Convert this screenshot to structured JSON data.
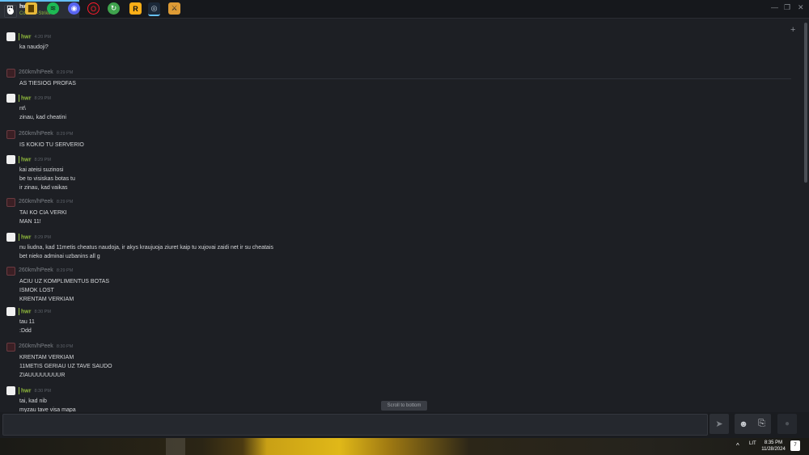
{
  "tab": {
    "name": "hwr",
    "game": "Counter-Strike 2"
  },
  "window_controls": {
    "minimize": "—",
    "restore": "❐",
    "close": "✕"
  },
  "messages": [
    {
      "sender": "hwr",
      "type": "hwr",
      "time": "4:20 PM",
      "lines": [
        "ka naudoji?"
      ]
    },
    {
      "sender": "260km/hPeek",
      "type": "peek",
      "time": "8:29 PM",
      "lines": [
        "AS TIESIOG PROFAS"
      ]
    },
    {
      "sender": "hwr",
      "type": "hwr",
      "time": "8:29 PM",
      "lines": [
        "nt\\",
        "zinau, kad cheatini"
      ]
    },
    {
      "sender": "260km/hPeek",
      "type": "peek",
      "time": "8:29 PM",
      "lines": [
        "IS KOKIO TU SERVERIO"
      ]
    },
    {
      "sender": "hwr",
      "type": "hwr",
      "time": "8:29 PM",
      "lines": [
        "kai ateisi suzinosi",
        "be to visiskas botas tu",
        "ir zinau, kad vaikas"
      ]
    },
    {
      "sender": "260km/hPeek",
      "type": "peek",
      "time": "8:29 PM",
      "lines": [
        "TAI KO CIA VERKI",
        "MAN 11!"
      ]
    },
    {
      "sender": "hwr",
      "type": "hwr",
      "time": "8:29 PM",
      "lines": [
        "nu liudna, kad 11metis cheatus naudoja, ir akys kraujuoja ziuret kaip tu xujovai zaidi net ir su cheatais",
        "bet nieko adminai uzbanins all g"
      ]
    },
    {
      "sender": "260km/hPeek",
      "type": "peek",
      "time": "8:29 PM",
      "lines": [
        "ACIU UZ KOMPLIMENTUS BOTAS",
        "ISMOK LOST",
        "KRENTAM VERKIAM"
      ]
    },
    {
      "sender": "hwr",
      "type": "hwr",
      "time": "8:30 PM",
      "lines": [
        "tau 11",
        ":Ddd"
      ]
    },
    {
      "sender": "260km/hPeek",
      "type": "peek",
      "time": "8:30 PM",
      "lines": [
        "KRENTAM VERKIAM",
        "11METIS GERIAU UZ TAVE SAUDO",
        "ZIAUUUUUUUUR"
      ]
    },
    {
      "sender": "hwr",
      "type": "hwr",
      "time": "8:30 PM",
      "lines": [
        "tai, kad nib",
        "myzau tave visa mapa"
      ]
    }
  ],
  "scroll_to_bottom": "Scroll to bottom",
  "input": {
    "placeholder": ""
  },
  "icons": {
    "send": "➤",
    "emoji": "☻",
    "attach": "⎘",
    "voice": "●",
    "add_friend": "+",
    "start": "⊞",
    "files": "▇",
    "spotify": "≋",
    "discord": "◉",
    "opera": "O",
    "app5": "↻",
    "rockstar": "R",
    "steam": "◎",
    "cs2": "⚔",
    "chevron": "^"
  },
  "taskbar": {
    "lang": "LIT",
    "time": "8:35 PM",
    "date": "11/28/2024",
    "notif_count": "7"
  }
}
